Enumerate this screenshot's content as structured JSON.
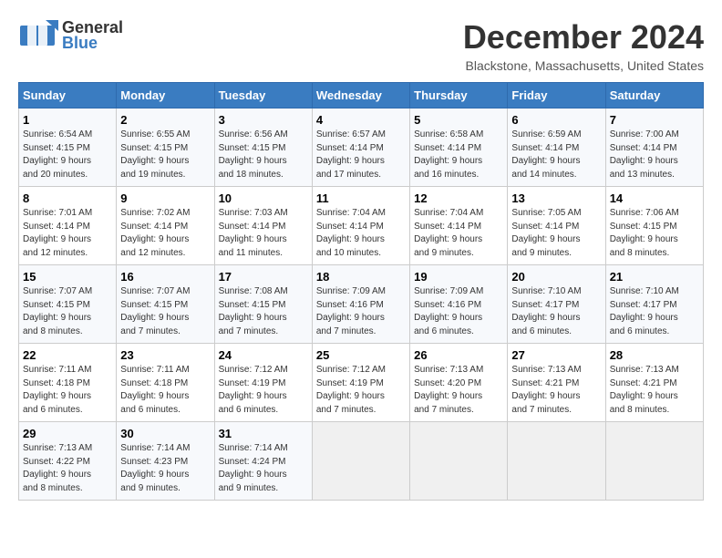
{
  "header": {
    "logo_general": "General",
    "logo_blue": "Blue",
    "month_title": "December 2024",
    "location": "Blackstone, Massachusetts, United States"
  },
  "days_of_week": [
    "Sunday",
    "Monday",
    "Tuesday",
    "Wednesday",
    "Thursday",
    "Friday",
    "Saturday"
  ],
  "weeks": [
    [
      {
        "day": "1",
        "sunrise": "6:54 AM",
        "sunset": "4:15 PM",
        "daylight": "9 hours and 20 minutes."
      },
      {
        "day": "2",
        "sunrise": "6:55 AM",
        "sunset": "4:15 PM",
        "daylight": "9 hours and 19 minutes."
      },
      {
        "day": "3",
        "sunrise": "6:56 AM",
        "sunset": "4:15 PM",
        "daylight": "9 hours and 18 minutes."
      },
      {
        "day": "4",
        "sunrise": "6:57 AM",
        "sunset": "4:14 PM",
        "daylight": "9 hours and 17 minutes."
      },
      {
        "day": "5",
        "sunrise": "6:58 AM",
        "sunset": "4:14 PM",
        "daylight": "9 hours and 16 minutes."
      },
      {
        "day": "6",
        "sunrise": "6:59 AM",
        "sunset": "4:14 PM",
        "daylight": "9 hours and 14 minutes."
      },
      {
        "day": "7",
        "sunrise": "7:00 AM",
        "sunset": "4:14 PM",
        "daylight": "9 hours and 13 minutes."
      }
    ],
    [
      {
        "day": "8",
        "sunrise": "7:01 AM",
        "sunset": "4:14 PM",
        "daylight": "9 hours and 12 minutes."
      },
      {
        "day": "9",
        "sunrise": "7:02 AM",
        "sunset": "4:14 PM",
        "daylight": "9 hours and 12 minutes."
      },
      {
        "day": "10",
        "sunrise": "7:03 AM",
        "sunset": "4:14 PM",
        "daylight": "9 hours and 11 minutes."
      },
      {
        "day": "11",
        "sunrise": "7:04 AM",
        "sunset": "4:14 PM",
        "daylight": "9 hours and 10 minutes."
      },
      {
        "day": "12",
        "sunrise": "7:04 AM",
        "sunset": "4:14 PM",
        "daylight": "9 hours and 9 minutes."
      },
      {
        "day": "13",
        "sunrise": "7:05 AM",
        "sunset": "4:14 PM",
        "daylight": "9 hours and 9 minutes."
      },
      {
        "day": "14",
        "sunrise": "7:06 AM",
        "sunset": "4:15 PM",
        "daylight": "9 hours and 8 minutes."
      }
    ],
    [
      {
        "day": "15",
        "sunrise": "7:07 AM",
        "sunset": "4:15 PM",
        "daylight": "9 hours and 8 minutes."
      },
      {
        "day": "16",
        "sunrise": "7:07 AM",
        "sunset": "4:15 PM",
        "daylight": "9 hours and 7 minutes."
      },
      {
        "day": "17",
        "sunrise": "7:08 AM",
        "sunset": "4:15 PM",
        "daylight": "9 hours and 7 minutes."
      },
      {
        "day": "18",
        "sunrise": "7:09 AM",
        "sunset": "4:16 PM",
        "daylight": "9 hours and 7 minutes."
      },
      {
        "day": "19",
        "sunrise": "7:09 AM",
        "sunset": "4:16 PM",
        "daylight": "9 hours and 6 minutes."
      },
      {
        "day": "20",
        "sunrise": "7:10 AM",
        "sunset": "4:17 PM",
        "daylight": "9 hours and 6 minutes."
      },
      {
        "day": "21",
        "sunrise": "7:10 AM",
        "sunset": "4:17 PM",
        "daylight": "9 hours and 6 minutes."
      }
    ],
    [
      {
        "day": "22",
        "sunrise": "7:11 AM",
        "sunset": "4:18 PM",
        "daylight": "9 hours and 6 minutes."
      },
      {
        "day": "23",
        "sunrise": "7:11 AM",
        "sunset": "4:18 PM",
        "daylight": "9 hours and 6 minutes."
      },
      {
        "day": "24",
        "sunrise": "7:12 AM",
        "sunset": "4:19 PM",
        "daylight": "9 hours and 6 minutes."
      },
      {
        "day": "25",
        "sunrise": "7:12 AM",
        "sunset": "4:19 PM",
        "daylight": "9 hours and 7 minutes."
      },
      {
        "day": "26",
        "sunrise": "7:13 AM",
        "sunset": "4:20 PM",
        "daylight": "9 hours and 7 minutes."
      },
      {
        "day": "27",
        "sunrise": "7:13 AM",
        "sunset": "4:21 PM",
        "daylight": "9 hours and 7 minutes."
      },
      {
        "day": "28",
        "sunrise": "7:13 AM",
        "sunset": "4:21 PM",
        "daylight": "9 hours and 8 minutes."
      }
    ],
    [
      {
        "day": "29",
        "sunrise": "7:13 AM",
        "sunset": "4:22 PM",
        "daylight": "9 hours and 8 minutes."
      },
      {
        "day": "30",
        "sunrise": "7:14 AM",
        "sunset": "4:23 PM",
        "daylight": "9 hours and 9 minutes."
      },
      {
        "day": "31",
        "sunrise": "7:14 AM",
        "sunset": "4:24 PM",
        "daylight": "9 hours and 9 minutes."
      },
      null,
      null,
      null,
      null
    ]
  ],
  "labels": {
    "sunrise": "Sunrise:",
    "sunset": "Sunset:",
    "daylight": "Daylight:"
  }
}
